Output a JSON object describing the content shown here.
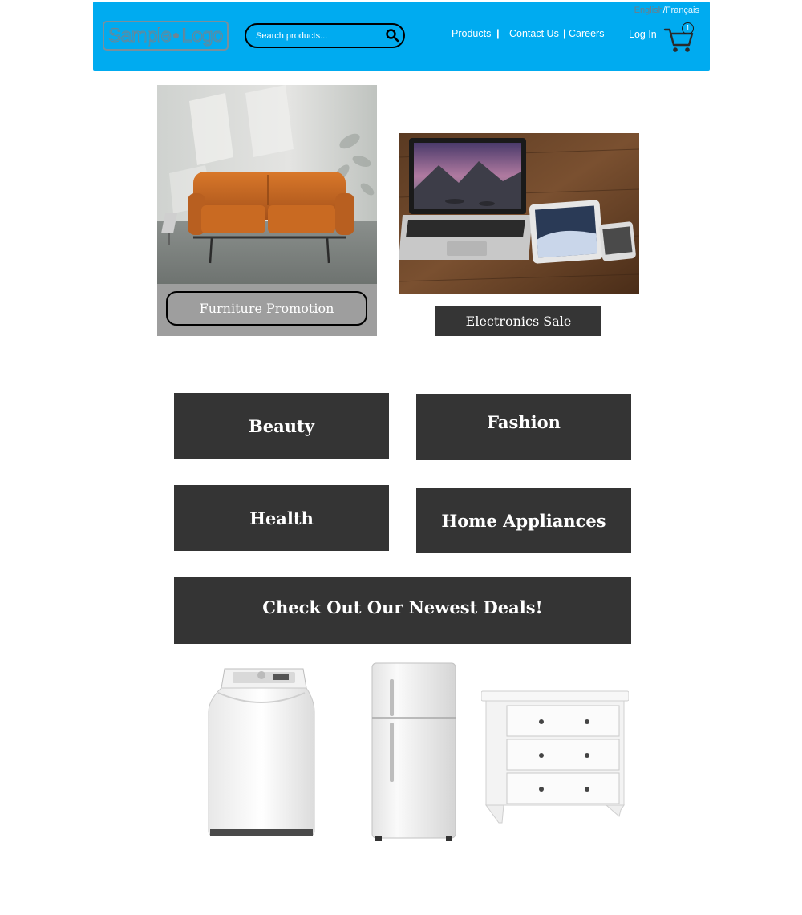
{
  "header": {
    "language": {
      "english": "English",
      "separator": "/",
      "french": "Français"
    },
    "logo": {
      "word1": "Sample",
      "word2": "Logo"
    },
    "search": {
      "placeholder": "Search products..."
    },
    "nav": {
      "products": "Products",
      "separator1": "|",
      "contact": "Contact Us",
      "separator2": "|",
      "careers": "Careers",
      "login": "Log In"
    },
    "cart": {
      "count": "1"
    },
    "colors": {
      "background": "#00abf0"
    }
  },
  "promotions": {
    "furniture": {
      "label": "Furniture Promotion",
      "image": "orange-sofa"
    },
    "electronics": {
      "label": "Electronics Sale",
      "image": "laptop-tablet-phone"
    }
  },
  "categories": [
    {
      "label": "Beauty"
    },
    {
      "label": "Fashion"
    },
    {
      "label": "Health"
    },
    {
      "label": "Home Appliances"
    }
  ],
  "deals": {
    "label": "Check Out Our Newest Deals!"
  },
  "products": [
    {
      "image": "washing-machine"
    },
    {
      "image": "refrigerator"
    },
    {
      "image": "dresser"
    }
  ]
}
